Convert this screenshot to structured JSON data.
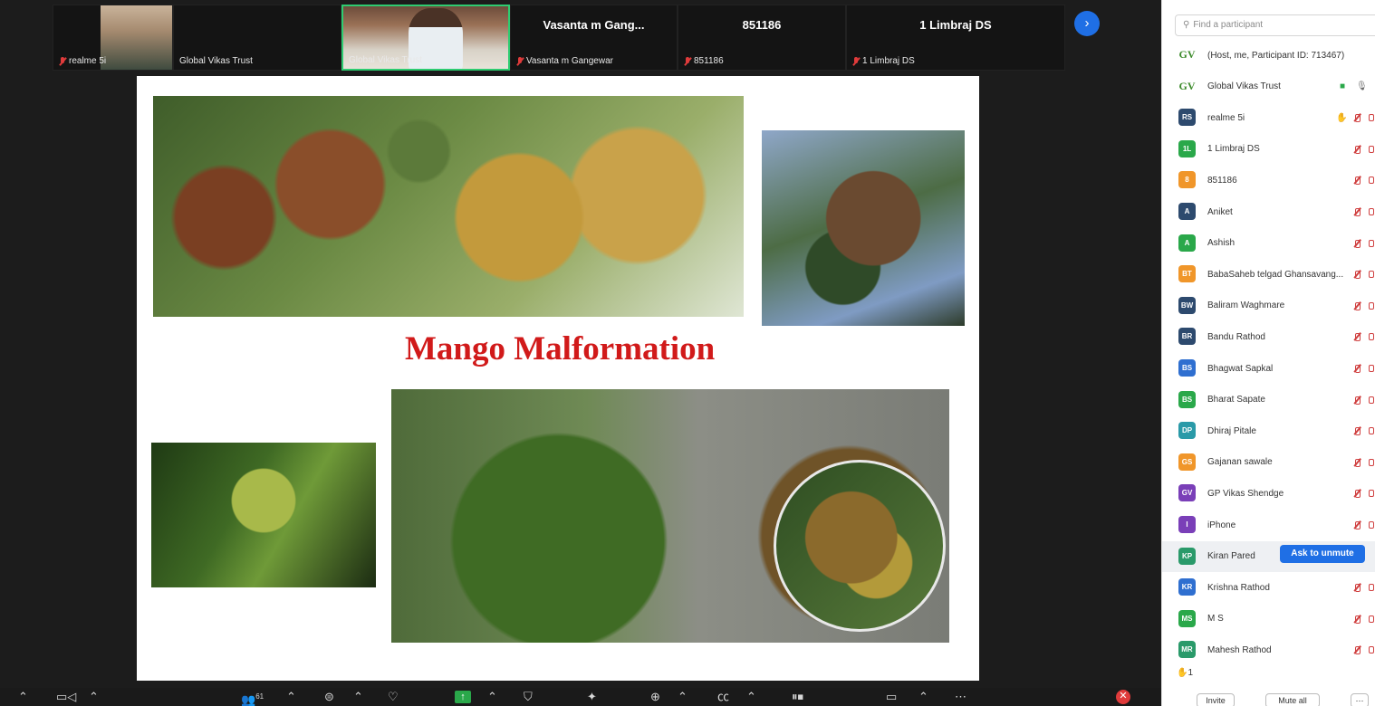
{
  "thumbnails": [
    {
      "name": "realme 5i",
      "muted": true
    },
    {
      "name": "Global Vikas Trust",
      "muted": false
    },
    {
      "name": "Global Vikas Trust",
      "muted": false
    },
    {
      "name": "Vasanta m Gangewar",
      "big": "Vasanta m Gang...",
      "muted": true
    },
    {
      "name": "851186",
      "big": "851186",
      "muted": true
    },
    {
      "name": "1 Limbraj DS",
      "big": "1 Limbraj DS",
      "muted": true
    }
  ],
  "slide": {
    "title": "Mango Malformation"
  },
  "toolbar": {
    "participants_count": "61"
  },
  "panel": {
    "search_placeholder": "Find a participant",
    "participants": [
      {
        "initials": "",
        "name": "(Host, me, Participant ID: 713467)",
        "color": "",
        "logo": true
      },
      {
        "initials": "",
        "name": "Global Vikas Trust",
        "color": "",
        "logo": true
      },
      {
        "initials": "RS",
        "name": "realme 5i",
        "color": "#2d4a6e",
        "hand": true
      },
      {
        "initials": "1L",
        "name": "1 Limbraj DS",
        "color": "#2aa84a"
      },
      {
        "initials": "8",
        "name": "851186",
        "color": "#f0962a"
      },
      {
        "initials": "A",
        "name": "Aniket",
        "color": "#2d4a6e"
      },
      {
        "initials": "A",
        "name": "Ashish",
        "color": "#2aa84a"
      },
      {
        "initials": "BT",
        "name": "BabaSaheb telgad Ghansavang...",
        "color": "#f0962a"
      },
      {
        "initials": "BW",
        "name": "Baliram Waghmare",
        "color": "#2d4a6e"
      },
      {
        "initials": "BR",
        "name": "Bandu Rathod",
        "color": "#2d4a6e"
      },
      {
        "initials": "BS",
        "name": "Bhagwat Sapkal",
        "color": "#2f6fd0"
      },
      {
        "initials": "BS",
        "name": "Bharat Sapate",
        "color": "#2aa84a"
      },
      {
        "initials": "DP",
        "name": "Dhiraj Pitale",
        "color": "#2a9aa8"
      },
      {
        "initials": "GS",
        "name": "Gajanan sawale",
        "color": "#f0962a"
      },
      {
        "initials": "GV",
        "name": "GP Vikas Shendge",
        "color": "#7a3fb8"
      },
      {
        "initials": "I",
        "name": "iPhone",
        "color": "#7a3fb8"
      },
      {
        "initials": "KP",
        "name": "Kiran Pared",
        "color": "#2a9a6a",
        "highlight": true
      },
      {
        "initials": "KR",
        "name": "Krishna Rathod",
        "color": "#2f6fd0"
      },
      {
        "initials": "MS",
        "name": "M S",
        "color": "#2aa84a"
      },
      {
        "initials": "MR",
        "name": "Mahesh Rathod",
        "color": "#2a9a6a"
      }
    ],
    "ask_to_unmute": "Ask to unmute",
    "hand_count": "1",
    "invite_label": "Invite",
    "mute_all_label": "Mute all"
  }
}
